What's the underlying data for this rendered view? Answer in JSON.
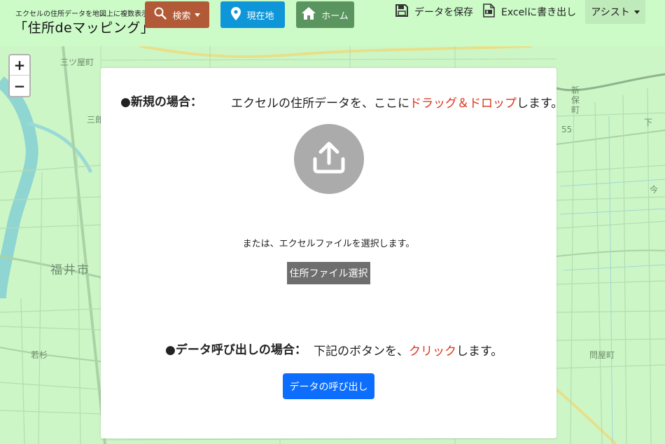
{
  "header": {
    "subtitle": "エクセルの住所データを地図上に複数表示",
    "title": "「住所deマッピング」",
    "search_label": "検索",
    "location_label": "現在地",
    "home_label": "ホーム",
    "save_label": "データを保存",
    "excel_label": "Excelに書き出し",
    "assist_label": "アシスト"
  },
  "zoom": {
    "in_label": "+",
    "out_label": "−"
  },
  "map": {
    "labels": [
      "三ツ屋町",
      "三郎",
      "福井市",
      "若杉",
      "新保町",
      "問屋町",
      "55",
      "下",
      "今"
    ]
  },
  "panel": {
    "new_heading": "●新規の場合：",
    "new_instruction_pre": "エクセルの住所データを、ここに",
    "new_instruction_highlight": "ドラッグ＆ドロップ",
    "new_instruction_post": "します。",
    "or_text": "または、エクセルファイルを選択します。",
    "file_button": "住所ファイル選択",
    "call_heading": "●データ呼び出しの場合：",
    "call_instruction_pre": "下記のボタンを、",
    "call_instruction_highlight": "クリック",
    "call_instruction_post": "します。",
    "call_button": "データの呼び出し"
  },
  "colors": {
    "search_button": "#b25a37",
    "location_button": "#0f96d8",
    "home_button": "#5a9560",
    "call_button": "#0d6efd",
    "highlight": "#d8361f",
    "header_bg": "#ccfbc8"
  }
}
